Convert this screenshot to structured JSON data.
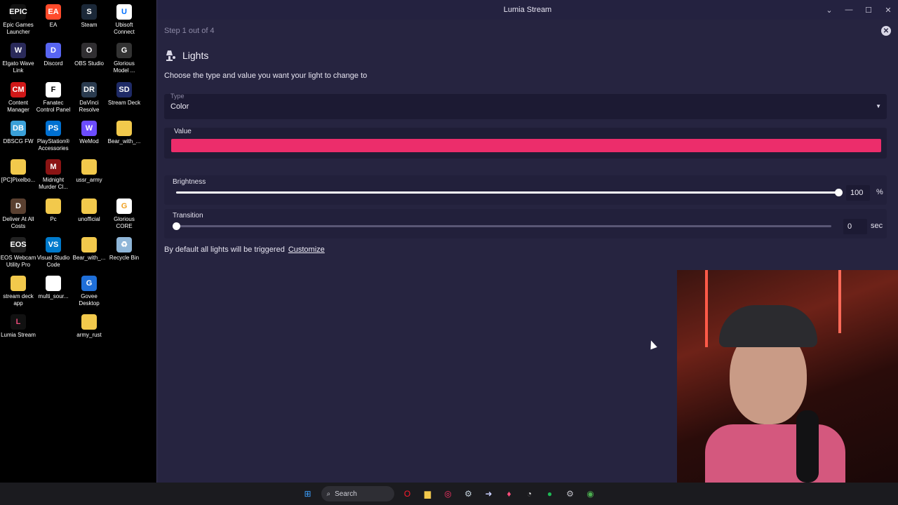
{
  "desktop": {
    "icons": [
      {
        "label": "Epic Games Launcher",
        "glyph": "EPIC",
        "color": "#111111",
        "fg": "#ffffff"
      },
      {
        "label": "EA",
        "glyph": "EA",
        "color": "#ff4b2b",
        "fg": "#ffffff"
      },
      {
        "label": "Steam",
        "glyph": "S",
        "color": "#1b2838",
        "fg": "#ffffff"
      },
      {
        "label": "Ubisoft Connect",
        "glyph": "U",
        "color": "#ffffff",
        "fg": "#0070ff"
      },
      {
        "label": "Elgato Wave Link",
        "glyph": "W",
        "color": "#2a2a5a",
        "fg": "#ffffff"
      },
      {
        "label": "Discord",
        "glyph": "D",
        "color": "#5865f2",
        "fg": "#ffffff"
      },
      {
        "label": "OBS Studio",
        "glyph": "O",
        "color": "#302e31",
        "fg": "#ffffff"
      },
      {
        "label": "Glorious Model ...",
        "glyph": "G",
        "color": "#333333",
        "fg": "#ffffff"
      },
      {
        "label": "Content Manager",
        "glyph": "CM",
        "color": "#d01818",
        "fg": "#ffffff"
      },
      {
        "label": "Fanatec Control Panel",
        "glyph": "F",
        "color": "#ffffff",
        "fg": "#000000"
      },
      {
        "label": "DaVinci Resolve",
        "glyph": "DR",
        "color": "#2a3b4f",
        "fg": "#ffffff"
      },
      {
        "label": "Stream Deck",
        "glyph": "SD",
        "color": "#1e2a66",
        "fg": "#ffffff"
      },
      {
        "label": "DBSCG FW",
        "glyph": "DB",
        "color": "#3aa0d8",
        "fg": "#ffffff"
      },
      {
        "label": "PlayStation® Accessories",
        "glyph": "PS",
        "color": "#0070d1",
        "fg": "#ffffff"
      },
      {
        "label": "WeMod",
        "glyph": "W",
        "color": "#6c4cff",
        "fg": "#ffffff"
      },
      {
        "label": "Bear_with_...",
        "glyph": "",
        "color": "#f2c94c",
        "fg": "#ffffff"
      },
      {
        "label": "[PC]Pixelbo...",
        "glyph": "",
        "color": "#f2c94c",
        "fg": "#ffffff"
      },
      {
        "label": "Midnight Murder Cl...",
        "glyph": "M",
        "color": "#8b1414",
        "fg": "#ffffff"
      },
      {
        "label": "ussr_army",
        "glyph": "",
        "color": "#f2c94c",
        "fg": "#ffffff"
      },
      {
        "label": "",
        "glyph": "",
        "color": "#000000",
        "fg": "#ffffff"
      },
      {
        "label": "Deliver At All Costs",
        "glyph": "D",
        "color": "#5a4030",
        "fg": "#ffffff"
      },
      {
        "label": "Pc",
        "glyph": "",
        "color": "#f2c94c",
        "fg": "#ffffff"
      },
      {
        "label": "unofficial",
        "glyph": "",
        "color": "#f2c94c",
        "fg": "#ffffff"
      },
      {
        "label": "Glorious CORE",
        "glyph": "G",
        "color": "#ffffff",
        "fg": "#f0a020"
      },
      {
        "label": "EOS Webcam Utility Pro",
        "glyph": "EOS",
        "color": "#222222",
        "fg": "#ffffff"
      },
      {
        "label": "Visual Studio Code",
        "glyph": "VS",
        "color": "#007acc",
        "fg": "#ffffff"
      },
      {
        "label": "Bear_with_...",
        "glyph": "",
        "color": "#f2c94c",
        "fg": "#ffffff"
      },
      {
        "label": "Recycle Bin",
        "glyph": "♻",
        "color": "#8fb6d8",
        "fg": "#ffffff"
      },
      {
        "label": "stream deck app",
        "glyph": "",
        "color": "#f2c94c",
        "fg": "#ffffff"
      },
      {
        "label": "multi_sour...",
        "glyph": "",
        "color": "#ffffff",
        "fg": "#000000"
      },
      {
        "label": "Govee Desktop",
        "glyph": "G",
        "color": "#1f6fd8",
        "fg": "#ffffff"
      },
      {
        "label": "",
        "glyph": "",
        "color": "#000000",
        "fg": "#ffffff"
      },
      {
        "label": "Lumia Stream",
        "glyph": "L",
        "color": "#111111",
        "fg": "#e94c7a"
      },
      {
        "label": "",
        "glyph": "",
        "color": "#000000",
        "fg": "#ffffff"
      },
      {
        "label": "army_rust",
        "glyph": "",
        "color": "#f2c94c",
        "fg": "#ffffff"
      },
      {
        "label": "",
        "glyph": "",
        "color": "#000000",
        "fg": "#ffffff"
      }
    ]
  },
  "window": {
    "title": "Lumia Stream",
    "controls": [
      "⌄",
      "—",
      "☐",
      "✕"
    ]
  },
  "wizard": {
    "step": "Step 1 out of 4",
    "close_glyph": "✕",
    "heading": "Lights",
    "heading_icon": "light-bulb-icon",
    "description": "Choose the type and value you want your light to change to",
    "type_label": "Type",
    "type_value": "Color",
    "value_label": "Value",
    "color_value": "#ec2d6b",
    "brightness": {
      "label": "Brightness",
      "value": "100",
      "unit": "%",
      "fraction": 1.0
    },
    "transition": {
      "label": "Transition",
      "value": "0",
      "unit": "sec",
      "fraction": 0.0
    },
    "footnote": "By default all lights will be triggered",
    "customize_link": "Customize"
  },
  "taskbar": {
    "search_placeholder": "Search",
    "icons": [
      "windows-start-icon",
      "opera-icon",
      "file-explorer-icon",
      "opera-gx-icon",
      "steam-icon",
      "arrow-app-icon",
      "lumia-icon",
      "chrome-update-icon",
      "spotify-icon",
      "settings-icon",
      "chrome-icon"
    ]
  }
}
